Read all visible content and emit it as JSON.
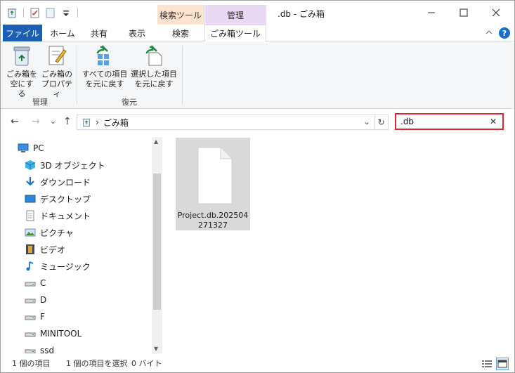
{
  "titlebar": {
    "context_tab_search": "検索ツール",
    "context_tab_manage": "管理",
    "window_title": ".db - ごみ箱",
    "minimize_icon": "minimize-icon",
    "maximize_icon": "maximize-icon",
    "close_icon": "close-icon"
  },
  "ribbon_tabs": {
    "file": "ファイル",
    "home": "ホーム",
    "share": "共有",
    "view": "表示",
    "search": "検索",
    "recycle_tools": "ごみ箱ツール"
  },
  "ribbon": {
    "empty_bin": {
      "line1": "ごみ箱を",
      "line2": "空にする"
    },
    "bin_properties": {
      "line1": "ごみ箱の",
      "line2": "プロパティ"
    },
    "group_manage": "管理",
    "restore_all": {
      "line1": "すべての項目",
      "line2": "を元に戻す"
    },
    "restore_selected": {
      "line1": "選択した項目",
      "line2": "を元に戻す"
    },
    "group_restore": "復元"
  },
  "address": {
    "separator": "›",
    "location": "ごみ箱",
    "dropdown": "⌄",
    "refresh": "↻"
  },
  "search": {
    "value": ".db",
    "clear": "✕"
  },
  "nav_arrows": {
    "back": "←",
    "forward": "→",
    "recent": "⌄",
    "up": "↑"
  },
  "tree": [
    {
      "label": "PC",
      "icon": "pc-icon"
    },
    {
      "label": "3D オブジェクト",
      "icon": "3d-objects-icon"
    },
    {
      "label": "ダウンロード",
      "icon": "download-icon"
    },
    {
      "label": "デスクトップ",
      "icon": "desktop-icon"
    },
    {
      "label": "ドキュメント",
      "icon": "documents-icon"
    },
    {
      "label": "ピクチャ",
      "icon": "pictures-icon"
    },
    {
      "label": "ビデオ",
      "icon": "videos-icon"
    },
    {
      "label": "ミュージック",
      "icon": "music-icon"
    },
    {
      "label": "C",
      "icon": "drive-icon"
    },
    {
      "label": "D",
      "icon": "drive-icon"
    },
    {
      "label": "F",
      "icon": "drive-icon"
    },
    {
      "label": "MINITOOL",
      "icon": "drive-icon"
    },
    {
      "label": "ssd",
      "icon": "drive-icon"
    }
  ],
  "files": [
    {
      "name": "Project.db.202504271327",
      "icon": "document-icon"
    }
  ],
  "status": {
    "item_count": "1 個の項目",
    "selected": "1 個の項目を選択",
    "size": "0 バイト"
  },
  "colors": {
    "file_tab": "#1a5fb4",
    "search_context": "#fde2d0",
    "manage_context": "#e8d8f3",
    "search_highlight": "#e4262a"
  }
}
